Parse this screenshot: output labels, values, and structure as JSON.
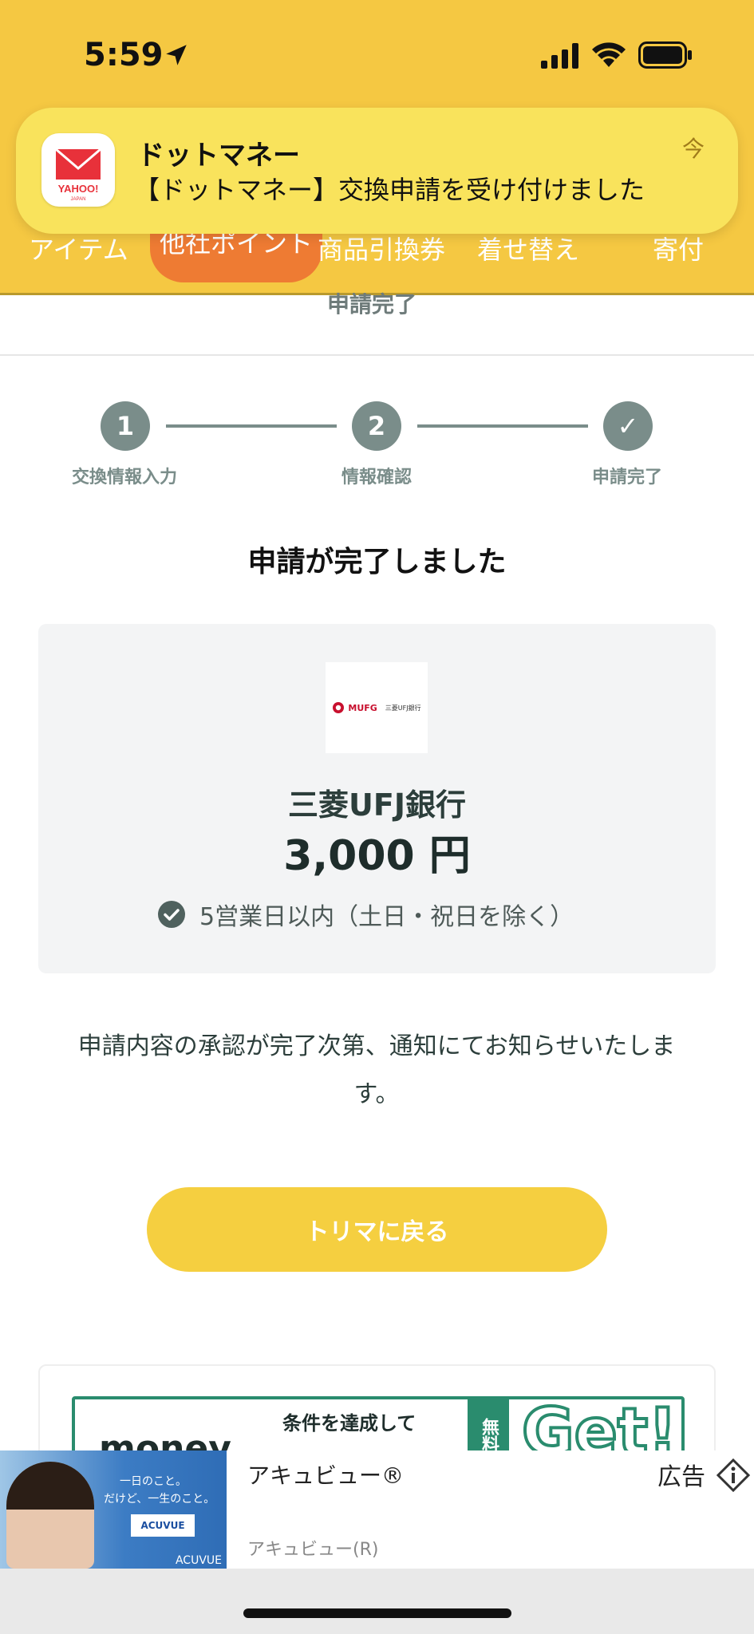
{
  "status_bar": {
    "time": "5:59"
  },
  "notification": {
    "app_name": "ドットマネー",
    "message": "【ドットマネー】交換申請を受け付けました",
    "time": "今",
    "icon_brand": "YAHOO!",
    "icon_brand_sub": "JAPAN"
  },
  "tabs": [
    {
      "label": "アイテム"
    },
    {
      "label": "他社ポイント"
    },
    {
      "label": "商品引換券"
    },
    {
      "label": "着せ替え"
    },
    {
      "label": "寄付"
    }
  ],
  "page_subtitle": "申請完了",
  "steps": [
    {
      "number": "1",
      "label": "交換情報入力"
    },
    {
      "number": "2",
      "label": "情報確認"
    },
    {
      "number": "✓",
      "label": "申請完了"
    }
  ],
  "heading": "申請が完了しました",
  "summary": {
    "bank_logo_text": "MUFG",
    "bank_logo_sub": "三菱UFJ銀行",
    "bank_name": "三菱UFJ銀行",
    "amount": "3,000 円",
    "eta": "5営業日以内（土日・祝日を除く）"
  },
  "notice": "申請内容の承認が完了次第、通知にてお知らせいたします。",
  "back_button": "トリマに戻る",
  "promo": {
    "logo": "money",
    "condition": "条件を達成して",
    "free_badge": "無料",
    "cta": "Get!"
  },
  "ad": {
    "title": "アキュビュー®",
    "subtitle": "アキュビュー(R)",
    "label": "広告",
    "image_copy1": "一日のこと。",
    "image_copy2": "だけど、一生のこと。",
    "image_box": "ACUVUE",
    "image_brand": "ACUVUE"
  },
  "colors": {
    "header_yellow": "#F5C842",
    "active_tab": "#EE7B33",
    "step_gray": "#7A8D8A",
    "button_yellow": "#F5CF40",
    "promo_green": "#2A8C6E"
  }
}
